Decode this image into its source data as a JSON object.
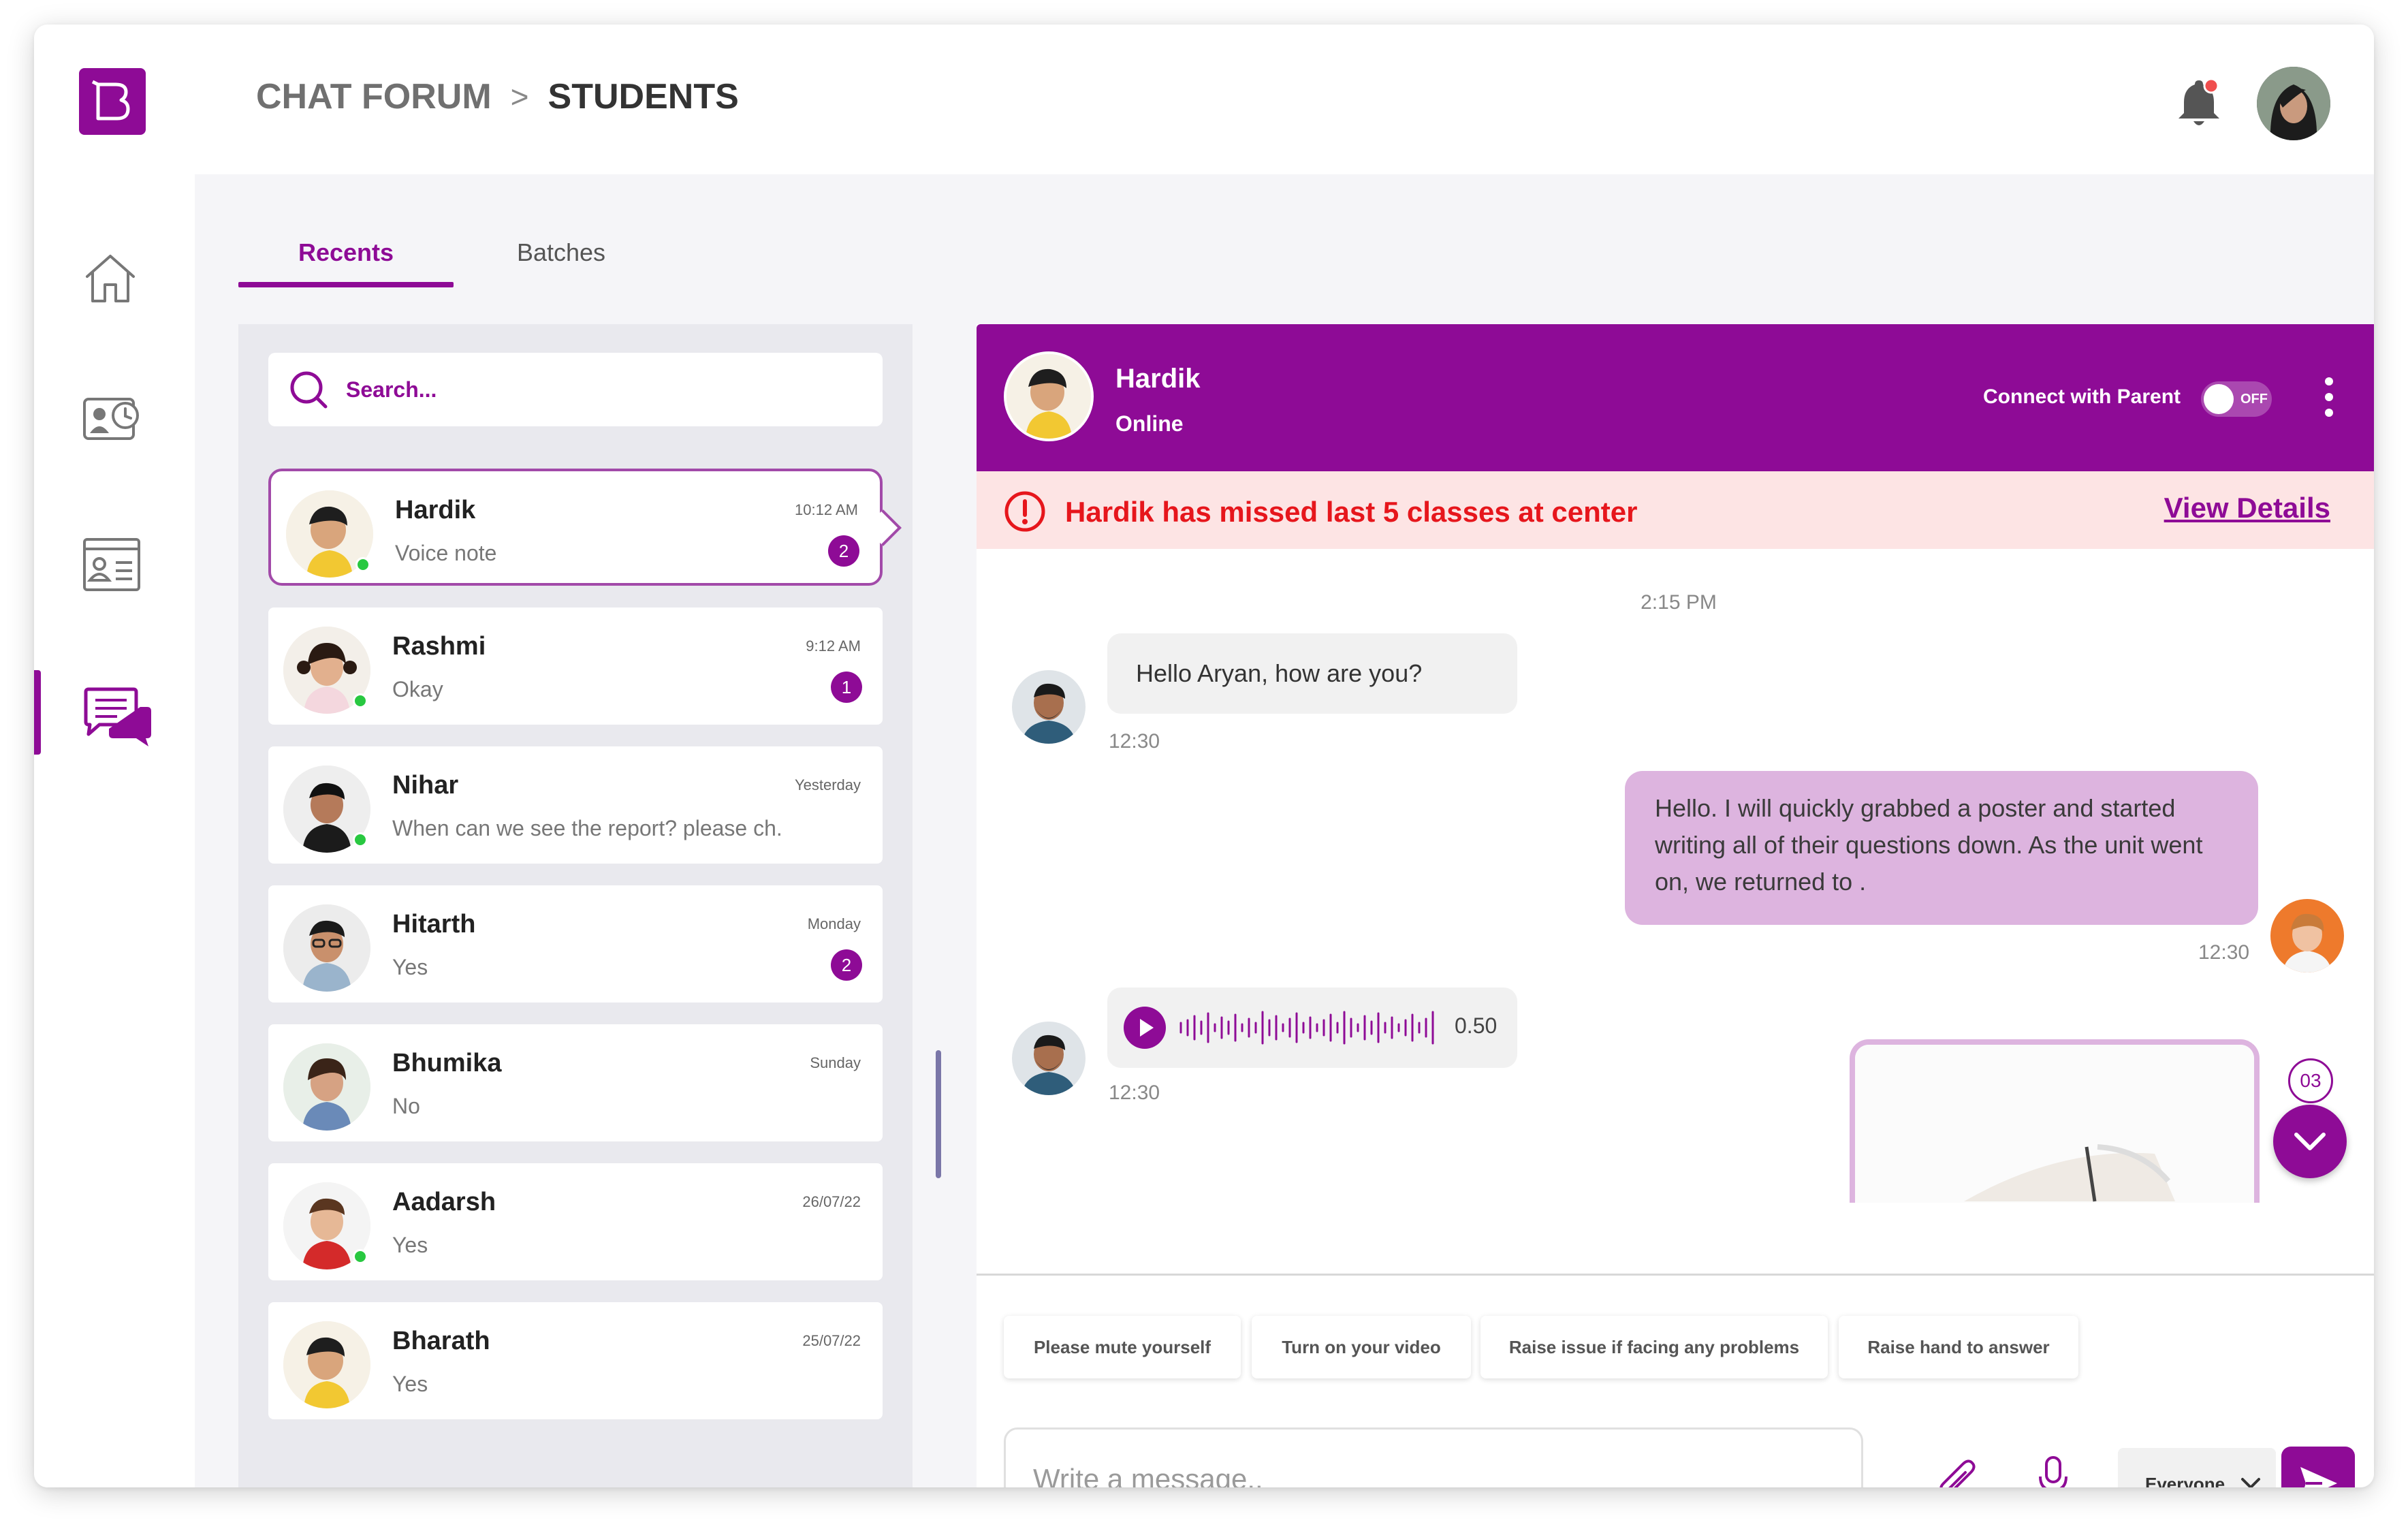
{
  "header": {
    "breadcrumb_root": "CHAT FORUM",
    "breadcrumb_separator": ">",
    "breadcrumb_current": "STUDENTS"
  },
  "colors": {
    "accent": "#8e0b96",
    "alert_bg": "#fde4e4",
    "alert_text": "#e6161c",
    "outgoing_bubble": "#ddb4df",
    "online_dot": "#28c840"
  },
  "nav": {
    "logo": "brand-logo",
    "items": [
      {
        "icon": "home-icon",
        "active": false
      },
      {
        "icon": "profile-card-icon",
        "active": false
      },
      {
        "icon": "id-card-icon",
        "active": false
      },
      {
        "icon": "chat-icon",
        "active": true
      }
    ]
  },
  "tabs": [
    {
      "label": "Recents",
      "active": true
    },
    {
      "label": "Batches",
      "active": false
    }
  ],
  "search": {
    "placeholder": "Search..."
  },
  "chats": [
    {
      "name": "Hardik",
      "message": "Voice note",
      "time": "10:12 AM",
      "unread": "2",
      "online": true,
      "active": true
    },
    {
      "name": "Rashmi",
      "message": "Okay",
      "time": "9:12 AM",
      "unread": "1",
      "online": true
    },
    {
      "name": "Nihar",
      "message": "When can we see the report? please ch.",
      "time": "Yesterday",
      "online": true
    },
    {
      "name": "Hitarth",
      "message": "Yes",
      "time": "Monday",
      "unread": "2",
      "online": false
    },
    {
      "name": "Bhumika",
      "message": "No",
      "time": "Sunday",
      "online": false
    },
    {
      "name": "Aadarsh",
      "message": "Yes",
      "time": "26/07/22",
      "online": true
    },
    {
      "name": "Bharath",
      "message": "Yes",
      "time": "25/07/22",
      "online": false
    }
  ],
  "conversation": {
    "name": "Hardik",
    "status": "Online",
    "connect_parent_label": "Connect with Parent",
    "toggle_label": "OFF",
    "alert_text": "Hardik has missed last 5 classes at center",
    "alert_link": "View Details",
    "time_separator": "2:15 PM",
    "messages": [
      {
        "text": "Hello Aryan, how are you?",
        "time": "12:30"
      },
      {
        "text": "Hello. I will quickly grabbed a poster and started writing all of their questions down. As the unit went on, we returned to .",
        "time": "12:30"
      },
      {
        "voice_duration": "0.50",
        "time": "12:30"
      }
    ],
    "new_messages_count": "03"
  },
  "quick_replies": [
    "Please mute yourself",
    "Turn on your video",
    "Raise issue if facing any problems",
    "Raise hand to answer"
  ],
  "composer": {
    "placeholder": "Write a message..",
    "audience": "Everyone"
  }
}
